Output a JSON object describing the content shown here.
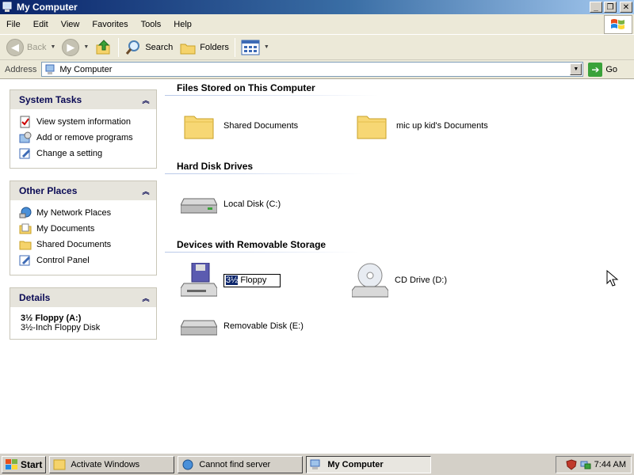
{
  "window": {
    "title": "My Computer",
    "buttons": {
      "minimize": "_",
      "maximize": "❐",
      "close": "✕"
    }
  },
  "menu": [
    "File",
    "Edit",
    "View",
    "Favorites",
    "Tools",
    "Help"
  ],
  "toolbar": {
    "back": "Back",
    "search": "Search",
    "folders": "Folders"
  },
  "address": {
    "label": "Address",
    "value": "My Computer",
    "go": "Go"
  },
  "left_pane": {
    "system_tasks": {
      "title": "System Tasks",
      "items": [
        "View system information",
        "Add or remove programs",
        "Change a setting"
      ]
    },
    "other_places": {
      "title": "Other Places",
      "items": [
        "My Network Places",
        "My Documents",
        "Shared Documents",
        "Control Panel"
      ]
    },
    "details": {
      "title": "Details",
      "name": "3½ Floppy (A:)",
      "type": "3½-Inch Floppy Disk"
    }
  },
  "content": {
    "files_section": "Files Stored on This Computer",
    "files": [
      "Shared Documents",
      "mic up kid's Documents"
    ],
    "hdd_section": "Hard Disk Drives",
    "hdd": [
      "Local Disk (C:)"
    ],
    "removable_section": "Devices with Removable Storage",
    "rename": {
      "selected": "3½",
      "rest": " Floppy"
    },
    "removable": [
      "CD Drive (D:)",
      "Removable Disk (E:)"
    ]
  },
  "taskbar": {
    "start": "Start",
    "tasks": [
      "Activate Windows",
      "Cannot find server",
      "My Computer"
    ],
    "clock": "7:44 AM"
  },
  "colors": {
    "title_gradient_start": "#0a246a",
    "selection": "#0a246a",
    "panel_header": "#e6e4dc"
  }
}
